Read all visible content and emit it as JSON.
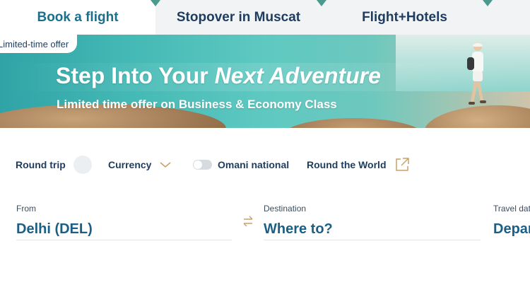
{
  "tabs": {
    "book_flight": "Book a flight",
    "stopover": "Stopover in Muscat",
    "flight_hotels": "Flight+Hotels"
  },
  "banner": {
    "badge": "Limited-time offer",
    "title_main": "Step Into Your ",
    "title_italic": "Next Adventure",
    "subtitle": "Limited time offer on Business & Economy Class"
  },
  "options": {
    "round_trip": "Round trip",
    "currency": "Currency",
    "omani_national": "Omani national",
    "omani_toggle_on": false,
    "round_the_world": "Round the World"
  },
  "fields": {
    "from_label": "From",
    "from_value": "Delhi (DEL)",
    "dest_label": "Destination",
    "dest_value": "Where to?",
    "date_label": "Travel date",
    "date_value": "Departure"
  },
  "icons": {
    "currency": "chevron-down-icon",
    "round_the_world": "external-link-icon",
    "swap": "swap-arrows-icon"
  },
  "colors": {
    "accent": "#1b6f8a",
    "text": "#1d3c5e",
    "swap_icon": "#c9a06a",
    "tab_marker": "#4c9a8e"
  }
}
